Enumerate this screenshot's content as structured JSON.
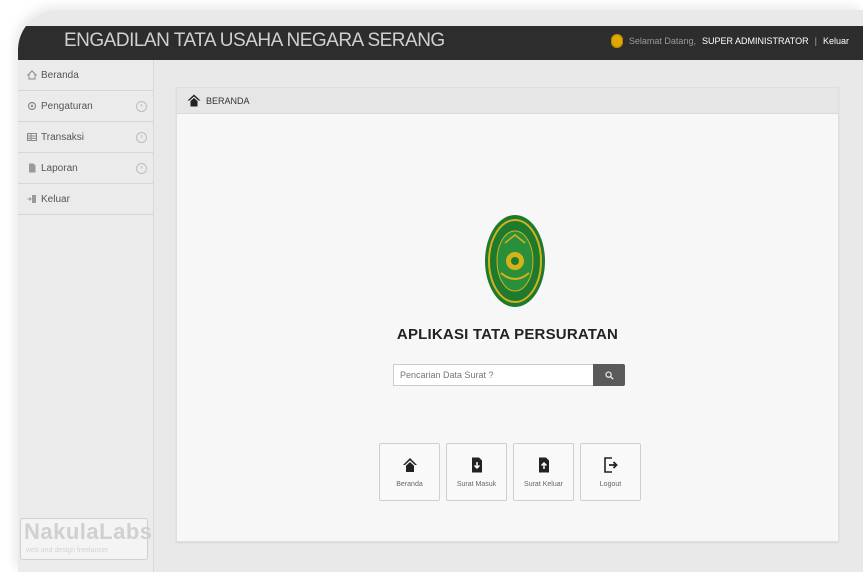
{
  "header": {
    "title": "ENGADILAN TATA USAHA NEGARA SERANG",
    "welcome_text": "Selamat Datang,",
    "user_name": "SUPER ADMINISTRATOR",
    "separator": "|",
    "logout_label": "Keluar"
  },
  "sidebar": {
    "items": [
      {
        "label": "Beranda",
        "icon": "home-icon"
      },
      {
        "label": "Pengaturan",
        "icon": "gear-icon"
      },
      {
        "label": "Transaksi",
        "icon": "table-icon"
      },
      {
        "label": "Laporan",
        "icon": "document-icon"
      },
      {
        "label": "Keluar",
        "icon": "logout-icon"
      }
    ],
    "chevron": "›",
    "brand": {
      "name": "NakulaLabs",
      "tagline": "web and design freelancer"
    }
  },
  "main": {
    "breadcrumb": "BERANDA",
    "app_heading": "APLIKASI TATA PERSURATAN",
    "search": {
      "placeholder": "Pencarian Data Surat ?"
    },
    "tiles": [
      {
        "label": "Beranda",
        "icon": "home-icon"
      },
      {
        "label": "Surat Masuk",
        "icon": "file-in-icon"
      },
      {
        "label": "Surat Keluar",
        "icon": "file-out-icon"
      },
      {
        "label": "Logout",
        "icon": "logout-icon"
      }
    ]
  },
  "colors": {
    "topbar": "#2d2d2d",
    "emblem_green": "#1e7a2e",
    "emblem_gold": "#d4b21a",
    "search_button": "#5a5a5a"
  }
}
